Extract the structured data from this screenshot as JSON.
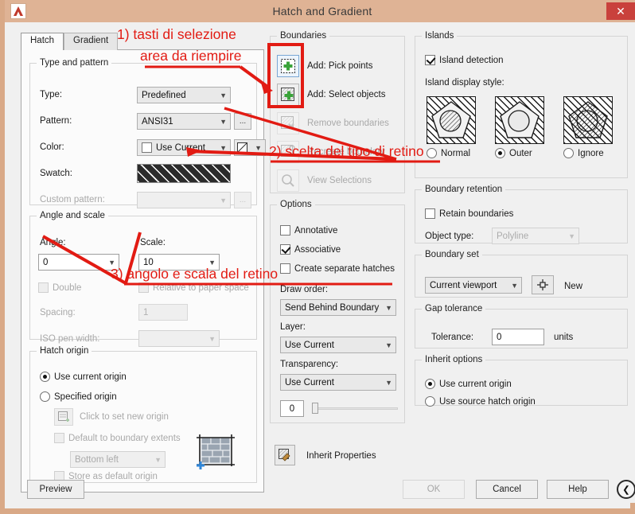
{
  "window": {
    "title": "Hatch and Gradient",
    "close_label": "✕",
    "app_icon": "autocad-logo-icon",
    "titlebar_color": "#dfb395",
    "close_color": "#c9413c",
    "annotation_color": "#e21b13"
  },
  "tabs": [
    {
      "label": "Hatch",
      "active": true
    },
    {
      "label": "Gradient",
      "active": false
    }
  ],
  "type_and_pattern": {
    "legend": "Type and pattern",
    "type_label": "Type:",
    "type_value": "Predefined",
    "pattern_label": "Pattern:",
    "pattern_value": "ANSI31",
    "pattern_browse_label": "...",
    "color_label": "Color:",
    "color_value": "Use Current",
    "color_swatch_label": "▨",
    "swatch_label": "Swatch:",
    "swatch_pattern": "ANSI31",
    "custom_pattern_label": "Custom pattern:",
    "custom_pattern_value": "",
    "custom_browse_label": "..."
  },
  "angle_and_scale": {
    "legend": "Angle and scale",
    "angle_label": "Angle:",
    "angle_value": "0",
    "scale_label": "Scale:",
    "scale_value": "10",
    "double_label": "Double",
    "relative_label": "Relative to paper space",
    "spacing_label": "Spacing:",
    "spacing_value": "1",
    "iso_pen_label": "ISO pen width:",
    "iso_pen_value": ""
  },
  "hatch_origin": {
    "legend": "Hatch origin",
    "use_current_label": "Use current origin",
    "specified_label": "Specified origin",
    "click_set_label": "Click to set new origin",
    "default_extents_label": "Default to boundary extents",
    "extents_value": "Bottom left",
    "store_default_label": "Store as default origin",
    "pick_icon": "set-origin-icon",
    "preview_icon": "origin-preview-icon"
  },
  "boundaries": {
    "legend": "Boundaries",
    "items": [
      {
        "label": "Add: Pick points",
        "icon": "pick-points-icon",
        "enabled": true,
        "selected": true
      },
      {
        "label": "Add: Select objects",
        "icon": "select-objects-icon",
        "enabled": true,
        "selected": false
      },
      {
        "label": "Remove boundaries",
        "icon": "remove-boundaries-icon",
        "enabled": false,
        "selected": false
      },
      {
        "label": "Recreate boundary",
        "icon": "recreate-boundary-icon",
        "enabled": false,
        "selected": false
      },
      {
        "label": "View Selections",
        "icon": "view-selections-icon",
        "enabled": false,
        "selected": false
      }
    ]
  },
  "options": {
    "legend": "Options",
    "annotative_label": "Annotative",
    "annotative_checked": false,
    "associative_label": "Associative",
    "associative_checked": true,
    "separate_label": "Create separate hatches",
    "separate_checked": false,
    "draw_order_label": "Draw order:",
    "draw_order_value": "Send Behind Boundary",
    "layer_label": "Layer:",
    "layer_value": "Use Current",
    "transparency_label": "Transparency:",
    "transparency_value": "Use Current",
    "transparency_number": "0"
  },
  "islands": {
    "legend": "Islands",
    "detection_label": "Island detection",
    "detection_checked": true,
    "display_style_label": "Island display style:",
    "styles": [
      {
        "label": "Normal",
        "selected": false,
        "icon": "island-normal-icon"
      },
      {
        "label": "Outer",
        "selected": true,
        "icon": "island-outer-icon"
      },
      {
        "label": "Ignore",
        "selected": false,
        "icon": "island-ignore-icon"
      }
    ]
  },
  "boundary_retention": {
    "legend": "Boundary retention",
    "retain_label": "Retain boundaries",
    "retain_checked": false,
    "object_type_label": "Object type:",
    "object_type_value": "Polyline"
  },
  "boundary_set": {
    "legend": "Boundary set",
    "value": "Current viewport",
    "pick_icon": "crosshair-icon",
    "new_label": "New"
  },
  "gap_tolerance": {
    "legend": "Gap tolerance",
    "tolerance_label": "Tolerance:",
    "tolerance_value": "0",
    "units_label": "units"
  },
  "inherit_options": {
    "legend": "Inherit options",
    "use_current_label": "Use current origin",
    "use_current_selected": true,
    "use_source_label": "Use source hatch origin",
    "use_source_selected": false
  },
  "footer": {
    "inherit_properties_label": "Inherit Properties",
    "inherit_properties_icon": "inherit-properties-icon",
    "preview_label": "Preview",
    "ok_label": "OK",
    "ok_enabled": false,
    "cancel_label": "Cancel",
    "help_label": "Help",
    "expand_label": "❮",
    "expand_icon": "expand-arrow-icon"
  },
  "annotations": [
    {
      "id": 1,
      "line1": "1) tasti di selezione",
      "line2": "area da riempire"
    },
    {
      "id": 2,
      "text": "2) scelta del tipo di retino"
    },
    {
      "id": 3,
      "text": "3) angolo e scala del retino"
    }
  ]
}
